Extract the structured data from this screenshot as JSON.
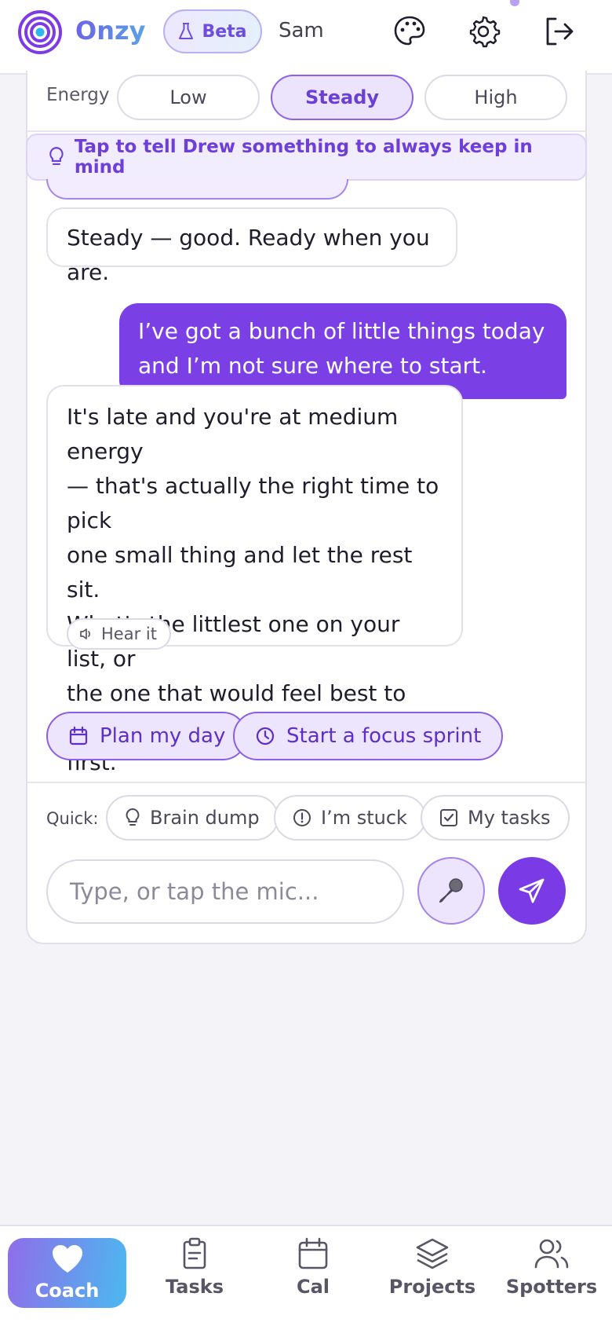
{
  "header": {
    "brand": "Onzy",
    "beta_label": "Beta",
    "user_name": "Sam",
    "icons": [
      "target-logo-icon",
      "flask-icon",
      "palette-icon",
      "gear-icon",
      "logout-icon"
    ]
  },
  "energy": {
    "label": "Energy",
    "options": [
      "Low",
      "Steady",
      "High"
    ],
    "selected": "Steady"
  },
  "memory_banner": {
    "text": "Tap to tell Drew something to always keep in mind",
    "icon": "lightbulb-icon"
  },
  "messages": [
    {
      "role": "coach",
      "text": "Steady — good. Ready when you are."
    },
    {
      "role": "user",
      "lines": [
        "I’ve got a bunch of little things today",
        "and I’m not sure where to start."
      ]
    },
    {
      "role": "coach",
      "lines": [
        "It's late and you're at medium energy",
        "— that's actually the right time to pick",
        "one small thing and let the rest sit.",
        "What's the littlest one on your list, or",
        "the one that would feel best to clear",
        "first."
      ],
      "hear_label": "Hear it"
    }
  ],
  "suggested_actions": [
    {
      "label": "Plan my day",
      "icon": "calendar-icon"
    },
    {
      "label": "Start a focus sprint",
      "icon": "clock-icon"
    }
  ],
  "quick": {
    "label": "Quick:",
    "chips": [
      {
        "label": "Brain dump",
        "icon": "lightbulb-icon"
      },
      {
        "label": "I’m stuck",
        "icon": "alert-circle-icon"
      },
      {
        "label": "My tasks",
        "icon": "checkbox-icon"
      }
    ]
  },
  "composer": {
    "placeholder": "Type, or tap the mic...",
    "value": ""
  },
  "nav": {
    "items": [
      "Coach",
      "Tasks",
      "Cal",
      "Projects",
      "Spotters"
    ],
    "active": "Coach"
  },
  "colors": {
    "accent": "#7b3fe6",
    "accent_soft": "#ede4fd",
    "brand_gradient_start": "#6d63e8",
    "brand_gradient_end": "#5aa2e6"
  }
}
